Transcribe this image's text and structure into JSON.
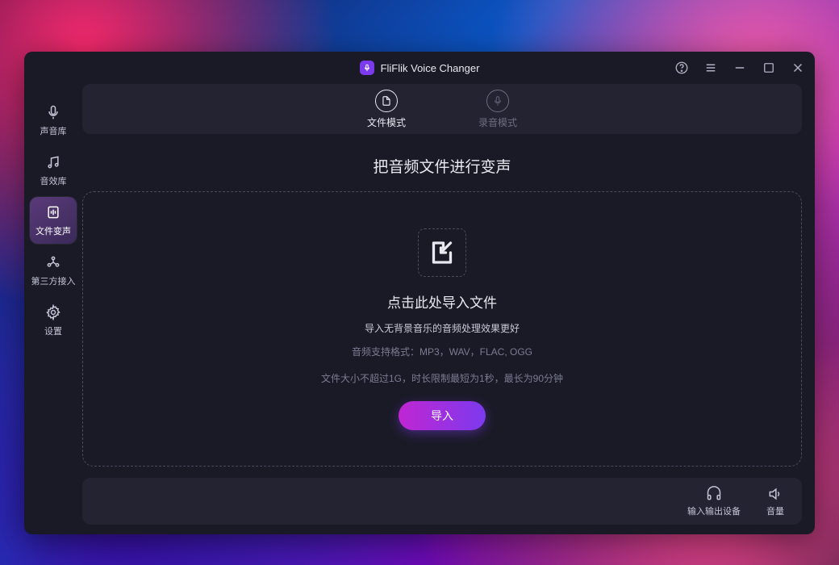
{
  "app": {
    "title": "FliFlik Voice Changer"
  },
  "sidebar": {
    "items": [
      {
        "label": "声音库"
      },
      {
        "label": "音效库"
      },
      {
        "label": "文件变声"
      },
      {
        "label": "第三方接入"
      },
      {
        "label": "设置"
      }
    ],
    "active_index": 2
  },
  "modes": {
    "file": "文件模式",
    "record": "录音模式",
    "active": "file"
  },
  "content": {
    "headline": "把音频文件进行变声",
    "drop_title": "点击此处导入文件",
    "drop_sub1": "导入无背景音乐的音频处理效果更好",
    "drop_sub2": "音频支持格式：MP3，WAV，FLAC, OGG",
    "drop_sub3": "文件大小不超过1G，时长限制最短为1秒，最长为90分钟",
    "import_button": "导入"
  },
  "footer": {
    "io_device": "输入输出设备",
    "volume": "音量"
  }
}
